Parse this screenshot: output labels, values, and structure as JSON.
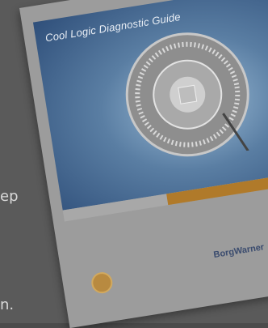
{
  "page": {
    "text_frag_1": "ep",
    "text_frag_2": "n."
  },
  "booklet": {
    "title": "Cool Logic Diagnostic Guide",
    "stripe_label": "",
    "brand": "BorgWarner"
  },
  "colors": {
    "cover_blue": "#2f4f7a",
    "stripe_orange": "#b07a2a",
    "brand_navy": "#3a4b6e"
  }
}
